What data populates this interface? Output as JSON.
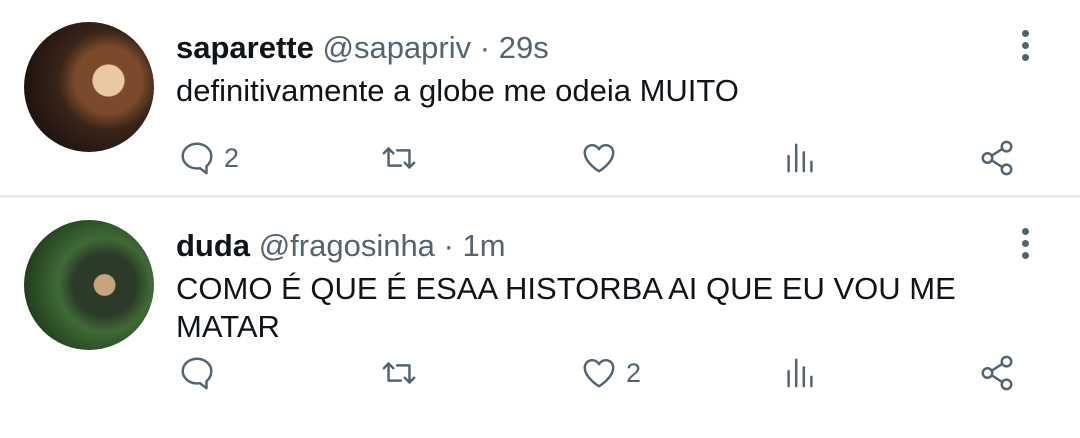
{
  "tweets": [
    {
      "name": "saparette",
      "handle": "@sapapriv",
      "separator": "·",
      "time": "29s",
      "text": "definitivamente a globe me odeia MUITO",
      "reply_count": "2",
      "retweet_count": "",
      "like_count": ""
    },
    {
      "name": "duda",
      "handle": "@fragosinha",
      "separator": "·",
      "time": "1m",
      "text": "COMO É QUE É ESAA HISTORBA AI QUE EU VOU ME MATAR",
      "reply_count": "",
      "retweet_count": "",
      "like_count": "2"
    }
  ],
  "icons": [
    "reply-icon",
    "retweet-icon",
    "like-icon",
    "views-icon",
    "share-icon",
    "more-icon"
  ],
  "colors": {
    "text": "#0f1419",
    "secondary": "#536471",
    "divider": "#e9ecee"
  }
}
